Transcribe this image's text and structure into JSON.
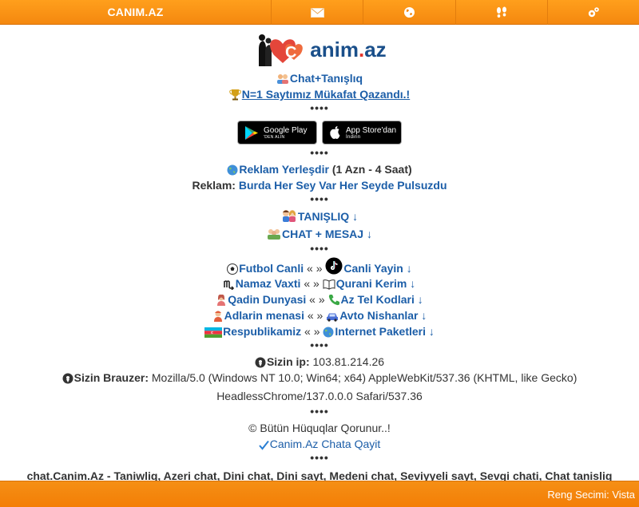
{
  "topbar": {
    "brand": "CANIM.AZ",
    "icons": [
      "envelope-icon",
      "globe-icon",
      "footprints-icon",
      "gear-icon"
    ]
  },
  "logo": {
    "text": "anim.az",
    "letter": "C"
  },
  "links": {
    "chat": "Chat+Tanışlıq",
    "award": "N=1 Saytımız Mükafat Qazandı.!"
  },
  "separator": "••••",
  "stores": {
    "google_top": "Google Play",
    "google_bottom": "'DEN ALIN",
    "apple_top": "App Store'dan",
    "apple_bottom": "İndirin"
  },
  "ad": {
    "place": "Reklam Yerleşdir",
    "price": "(1 Azn - 4 Saat)",
    "label": "Reklam:",
    "text": "Burda Her Sey Var Her Seyde Pulsuzdu"
  },
  "sections": {
    "dating": "TANIŞLIQ",
    "chat": "CHAT + MESAJ",
    "arrow": "↓"
  },
  "menu": {
    "sep": "« »",
    "rows": [
      {
        "left": "Futbol Canli",
        "right": "Canli Yayin"
      },
      {
        "left": "Namaz Vaxti",
        "right": "Qurani Kerim"
      },
      {
        "left": "Qadin Dunyasi",
        "right": "Az Tel Kodlari"
      },
      {
        "left": "Adlarin menasi",
        "right": "Avto Nishanlar"
      },
      {
        "left": "Respublikamiz",
        "right": "Internet Paketleri"
      }
    ]
  },
  "info": {
    "ip_label": "Sizin ip:",
    "ip": "103.81.214.26",
    "browser_label": "Sizin Brauzer:",
    "browser_line1": "Mozilla/5.0 (Windows NT 10.0; Win64; x64) AppleWebKit/537.36 (KHTML, like Gecko)",
    "browser_line2": "HeadlessChrome/137.0.0.0 Safari/537.36"
  },
  "copyright": "© Bütün Hüquqlar Qorunur..!",
  "back_link": "Canim.Az Chata Qayit",
  "seo": "chat.Canim.Az - Taniwliq, Azeri chat, Dini chat, Dini sayt, Medeni chat, Seviyyeli sayt, Sevgi chati, Chat tanisliq",
  "footer": {
    "theme": "Reng Secimi: Vista"
  },
  "colors": {
    "orange": "#f4880f",
    "link": "#1c5ea8"
  }
}
